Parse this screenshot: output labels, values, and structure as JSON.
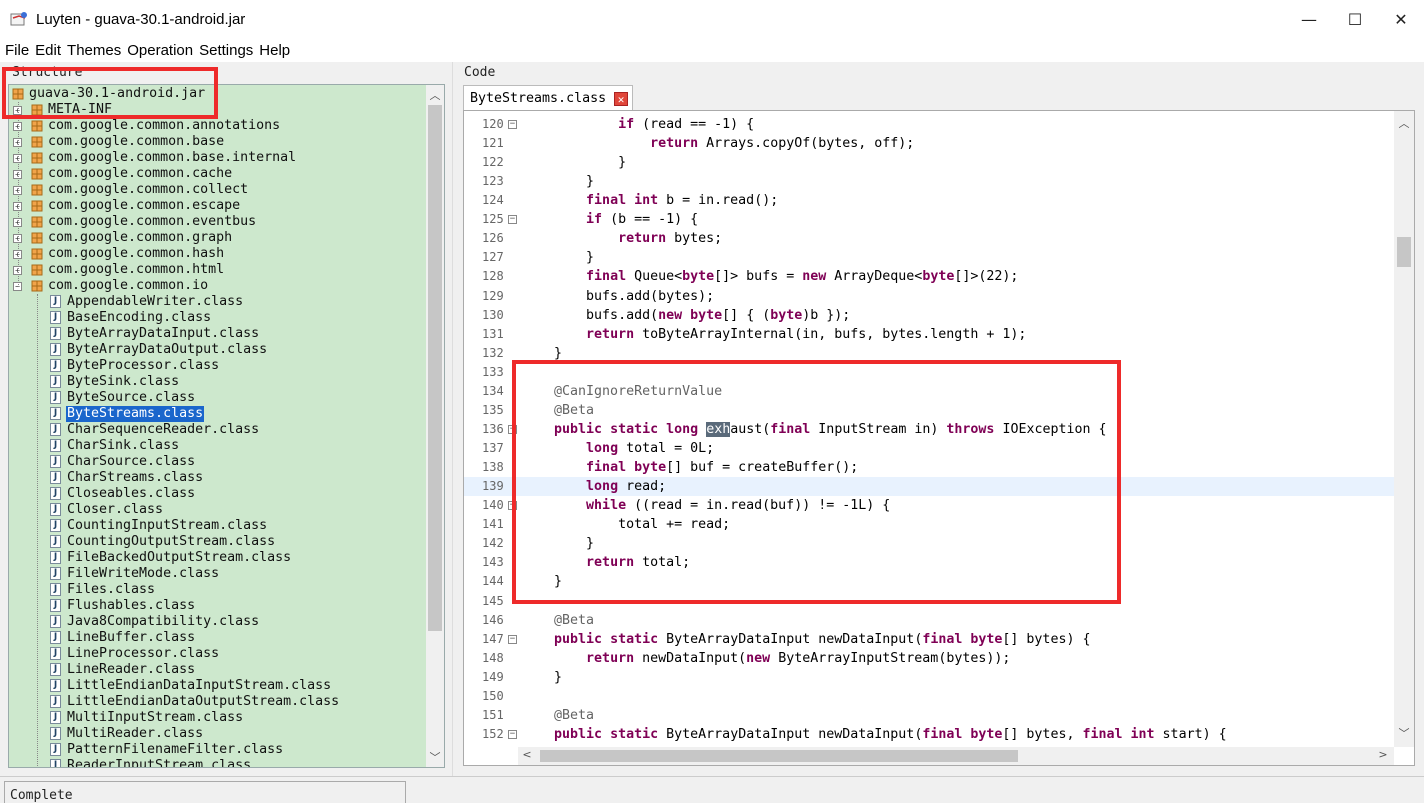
{
  "window": {
    "title": "Luyten - guava-30.1-android.jar",
    "controls": [
      "—",
      "☐",
      "✕"
    ]
  },
  "menu": [
    "File",
    "Edit",
    "Themes",
    "Operation",
    "Settings",
    "Help"
  ],
  "structure": {
    "label": "Structure",
    "root": "guava-30.1-android.jar",
    "packages": [
      "META-INF",
      "com.google.common.annotations",
      "com.google.common.base",
      "com.google.common.base.internal",
      "com.google.common.cache",
      "com.google.common.collect",
      "com.google.common.escape",
      "com.google.common.eventbus",
      "com.google.common.graph",
      "com.google.common.hash",
      "com.google.common.html",
      "com.google.common.io"
    ],
    "classes": [
      "AppendableWriter.class",
      "BaseEncoding.class",
      "ByteArrayDataInput.class",
      "ByteArrayDataOutput.class",
      "ByteProcessor.class",
      "ByteSink.class",
      "ByteSource.class",
      "ByteStreams.class",
      "CharSequenceReader.class",
      "CharSink.class",
      "CharSource.class",
      "CharStreams.class",
      "Closeables.class",
      "Closer.class",
      "CountingInputStream.class",
      "CountingOutputStream.class",
      "FileBackedOutputStream.class",
      "FileWriteMode.class",
      "Files.class",
      "Flushables.class",
      "Java8Compatibility.class",
      "LineBuffer.class",
      "LineProcessor.class",
      "LineReader.class",
      "LittleEndianDataInputStream.class",
      "LittleEndianDataOutputStream.class",
      "MultiInputStream.class",
      "MultiReader.class",
      "PatternFilenameFilter.class",
      "ReaderInputStream.class"
    ],
    "selected": "ByteStreams.class"
  },
  "code": {
    "label": "Code",
    "tab": "ByteStreams.class",
    "search_term": "exh",
    "lines": [
      {
        "n": "120",
        "t": "            if (read == -1) {",
        "fold": true
      },
      {
        "n": "121",
        "t": "                return Arrays.copyOf(bytes, off);"
      },
      {
        "n": "122",
        "t": "            }"
      },
      {
        "n": "123",
        "t": "        }"
      },
      {
        "n": "124",
        "t": "        final int b = in.read();"
      },
      {
        "n": "125",
        "t": "        if (b == -1) {",
        "fold": true
      },
      {
        "n": "126",
        "t": "            return bytes;"
      },
      {
        "n": "127",
        "t": "        }"
      },
      {
        "n": "128",
        "t": "        final Queue<byte[]> bufs = new ArrayDeque<byte[]>(22);"
      },
      {
        "n": "129",
        "t": "        bufs.add(bytes);"
      },
      {
        "n": "130",
        "t": "        bufs.add(new byte[] { (byte)b });"
      },
      {
        "n": "131",
        "t": "        return toByteArrayInternal(in, bufs, bytes.length + 1);"
      },
      {
        "n": "132",
        "t": "    }"
      },
      {
        "n": "133",
        "t": ""
      },
      {
        "n": "134",
        "t": "    @CanIgnoreReturnValue"
      },
      {
        "n": "135",
        "t": "    @Beta"
      },
      {
        "n": "136",
        "t": "    public static long exhaust(final InputStream in) throws IOException {",
        "fold": true
      },
      {
        "n": "137",
        "t": "        long total = 0L;"
      },
      {
        "n": "138",
        "t": "        final byte[] buf = createBuffer();"
      },
      {
        "n": "139",
        "t": "        long read;",
        "highlight": true
      },
      {
        "n": "140",
        "t": "        while ((read = in.read(buf)) != -1L) {",
        "fold": true
      },
      {
        "n": "141",
        "t": "            total += read;"
      },
      {
        "n": "142",
        "t": "        }"
      },
      {
        "n": "143",
        "t": "        return total;"
      },
      {
        "n": "144",
        "t": "    }"
      },
      {
        "n": "145",
        "t": ""
      },
      {
        "n": "146",
        "t": "    @Beta"
      },
      {
        "n": "147",
        "t": "    public static ByteArrayDataInput newDataInput(final byte[] bytes) {",
        "fold": true
      },
      {
        "n": "148",
        "t": "        return newDataInput(new ByteArrayInputStream(bytes));"
      },
      {
        "n": "149",
        "t": "    }"
      },
      {
        "n": "150",
        "t": ""
      },
      {
        "n": "151",
        "t": "    @Beta"
      },
      {
        "n": "152",
        "t": "    public static ByteArrayDataInput newDataInput(final byte[] bytes, final int start) {",
        "fold": true
      }
    ]
  },
  "status": "Complete",
  "colors": {
    "tree_bg": "#cde8cd",
    "selection": "#1a66cc",
    "keyword": "#7f0055",
    "annotation_box": "#ee2a2a",
    "line_highlight": "#e8f2fe"
  }
}
